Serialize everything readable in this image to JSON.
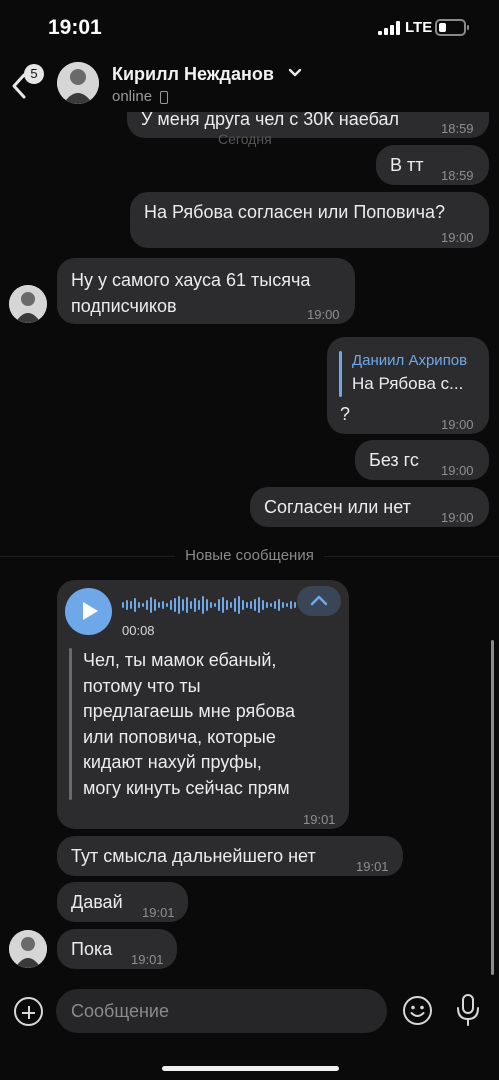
{
  "status_bar": {
    "time": "19:01",
    "network": "LTE",
    "battery_level": 0.3
  },
  "header": {
    "back_badge": "5",
    "contact_name": "Кирилл Нежданов",
    "status": "online"
  },
  "date_ghost": "Сегодня",
  "messages_top": [
    {
      "text": "У меня друга чел с 30К наебал",
      "time": "18:59"
    },
    {
      "text": "В тт",
      "time": "18:59"
    },
    {
      "text": "На Рябова согласен или Поповича?",
      "time": "19:00"
    },
    {
      "text1": "Ну у самого хауса 61 тысяча",
      "text2": "подписчиков",
      "time": "19:00"
    },
    {
      "quote_author": "Даниил Ахрипов",
      "quote_text": "На Рябова с...",
      "text": "?",
      "time": "19:00"
    },
    {
      "text": "Без гс",
      "time": "19:00"
    },
    {
      "text": "Согласен или нет",
      "time": "19:00"
    }
  ],
  "new_messages_label": "Новые сообщения",
  "voice_message": {
    "duration": "00:08",
    "transcript": [
      "Чел, ты мамок ебаный,",
      "потому что ты",
      "предлагаешь мне рябова",
      "или поповича, которые",
      "кидают нахуй пруфы,",
      "могу кинуть сейчас прям"
    ],
    "time": "19:01"
  },
  "messages_bottom": [
    {
      "text": "Тут смысла дальнейшего нет",
      "time": "19:01"
    },
    {
      "text": "Давай",
      "time": "19:01"
    },
    {
      "text": "Пока",
      "time": "19:01"
    }
  ],
  "input": {
    "placeholder": "Сообщение"
  },
  "colors": {
    "accent": "#6fa8e8",
    "bubble": "#2c2c2e",
    "background": "#0a0a0a"
  },
  "icons": [
    "back-icon",
    "chevron-down-icon",
    "phone-icon",
    "play-icon",
    "waveform-icon",
    "chevron-up-icon",
    "plus-icon",
    "smile-icon",
    "microphone-icon"
  ]
}
